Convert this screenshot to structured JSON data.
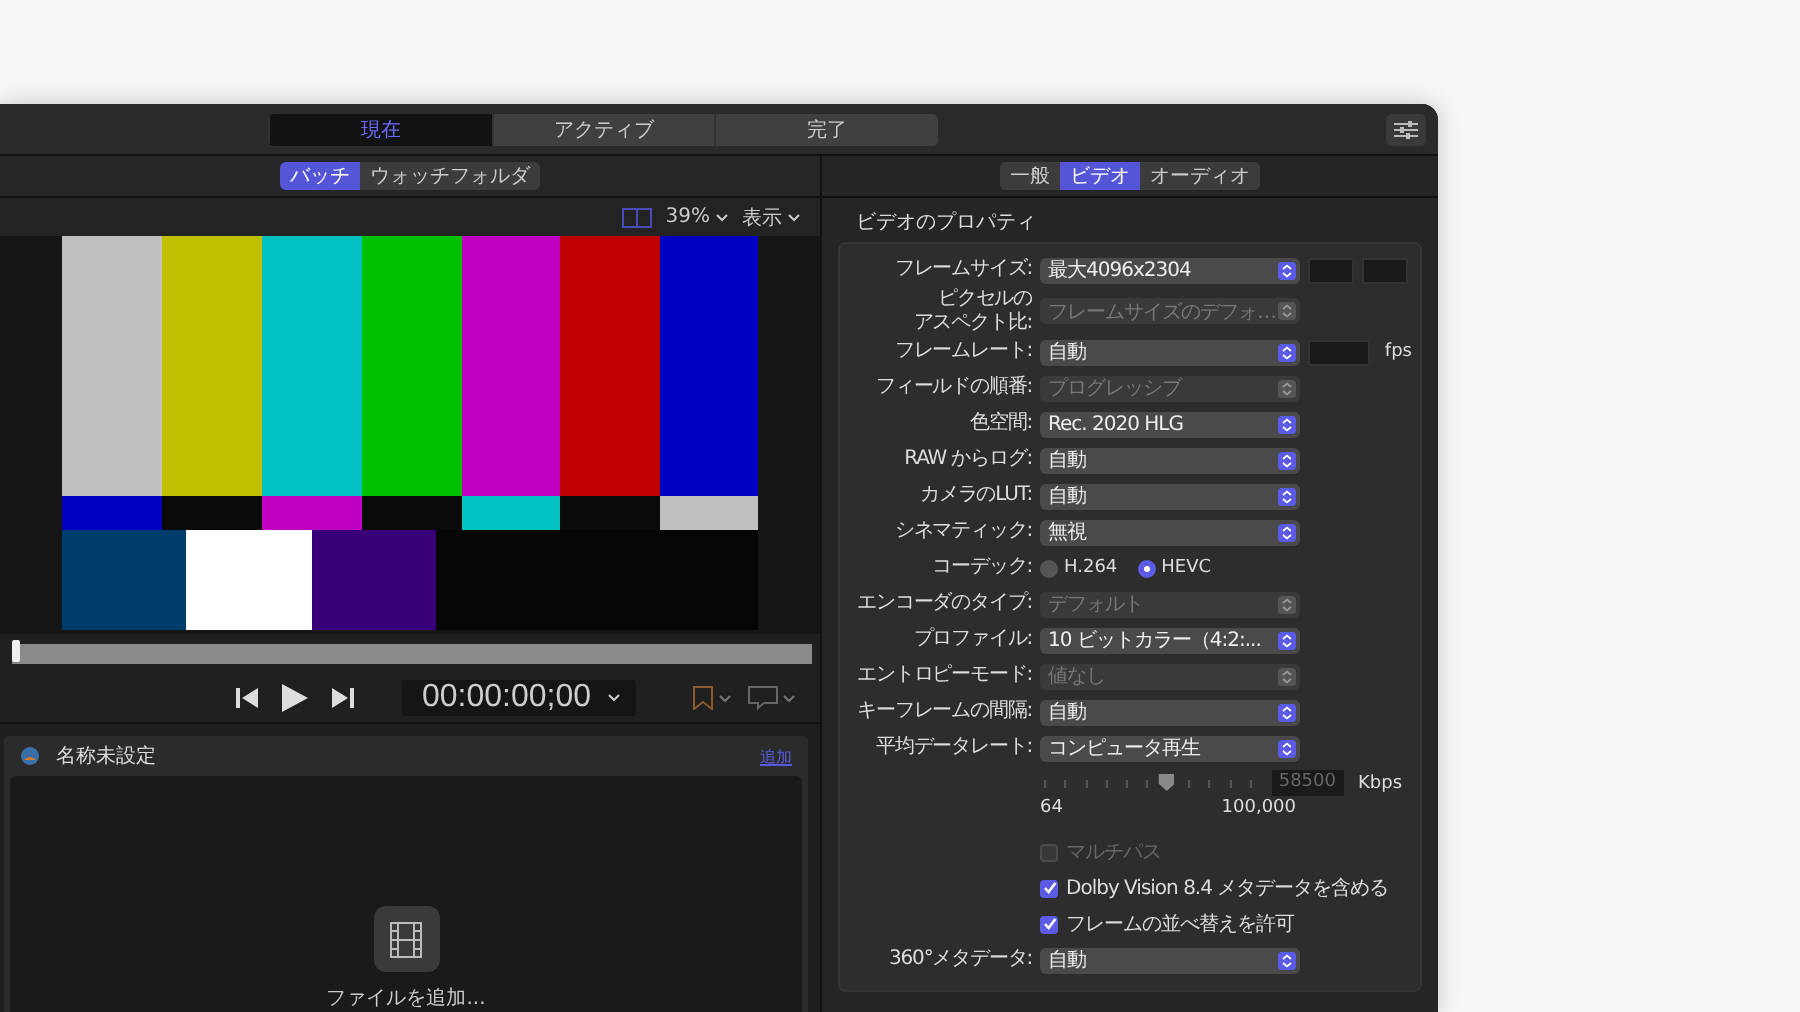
{
  "top_tabs": [
    {
      "label": "現在",
      "selected": true
    },
    {
      "label": "アクティブ",
      "selected": false
    },
    {
      "label": "完了",
      "selected": false
    }
  ],
  "left": {
    "source_tabs": [
      {
        "label": "バッチ",
        "selected": true
      },
      {
        "label": "ウォッチフォルダ",
        "selected": false
      }
    ],
    "zoom": "39%",
    "view_menu": "表示",
    "playhead": {
      "level": 0
    },
    "timecode": "00:00:00;00"
  },
  "batch": {
    "title": "名称未設定",
    "add_link": "追加",
    "drop_label": "ファイルを追加..."
  },
  "inspector": {
    "tabs": [
      {
        "label": "一般",
        "selected": false
      },
      {
        "label": "ビデオ",
        "selected": true
      },
      {
        "label": "オーディオ",
        "selected": false
      }
    ],
    "section_title": "ビデオのプロパティ",
    "rows": [
      {
        "kind": "popup",
        "label": "フレームサイズ:",
        "value": "最大4096x2304",
        "disabled": false,
        "size_fields": true
      },
      {
        "kind": "popup",
        "label_lines": [
          "ピクセルの",
          "アスペクト比:"
        ],
        "value": "フレームサイズのデフォ…",
        "disabled": true
      },
      {
        "kind": "popup",
        "label": "フレームレート:",
        "value": "自動",
        "disabled": false,
        "rate_field": true,
        "unit": "fps"
      },
      {
        "kind": "popup",
        "label": "フィールドの順番:",
        "value": "プログレッシブ",
        "disabled": true
      },
      {
        "kind": "popup",
        "label": "色空間:",
        "value": "Rec. 2020 HLG",
        "disabled": false
      },
      {
        "kind": "popup",
        "label": "RAW からログ:",
        "value": "自動",
        "disabled": false
      },
      {
        "kind": "popup",
        "label": "カメラのLUT:",
        "value": "自動",
        "disabled": false
      },
      {
        "kind": "popup",
        "label": "シネマティック:",
        "value": "無視",
        "disabled": false
      },
      {
        "kind": "radio",
        "label": "コーデック:",
        "options": [
          {
            "label": "H.264",
            "selected": false
          },
          {
            "label": "HEVC",
            "selected": true
          }
        ]
      },
      {
        "kind": "popup",
        "label": "エンコーダのタイプ:",
        "value": "デフォルト",
        "disabled": true
      },
      {
        "kind": "popup",
        "label": "プロファイル:",
        "value": "10 ビットカラー（4:2:...",
        "disabled": false
      },
      {
        "kind": "popup",
        "label": "エントロピーモード:",
        "value": "値なし",
        "disabled": true
      },
      {
        "kind": "popup",
        "label": "キーフレームの間隔:",
        "value": "自動",
        "disabled": false
      },
      {
        "kind": "popup",
        "label": "平均データレート:",
        "value": "コンピュータ再生",
        "disabled": false
      },
      {
        "kind": "slider",
        "level": 0.59,
        "value": "58500",
        "unit": "Kbps",
        "min_label": "64",
        "max_label": "100,000"
      },
      {
        "kind": "checkbox",
        "label": "マルチパス",
        "checked": false,
        "disabled": true
      },
      {
        "kind": "checkbox",
        "label": "Dolby Vision 8.4 メタデータを含める",
        "checked": true,
        "disabled": false
      },
      {
        "kind": "checkbox",
        "label": "フレームの並べ替えを許可",
        "checked": true,
        "disabled": false
      },
      {
        "kind": "popup",
        "label": "360°メタデータ:",
        "value": "自動",
        "disabled": false
      }
    ]
  }
}
